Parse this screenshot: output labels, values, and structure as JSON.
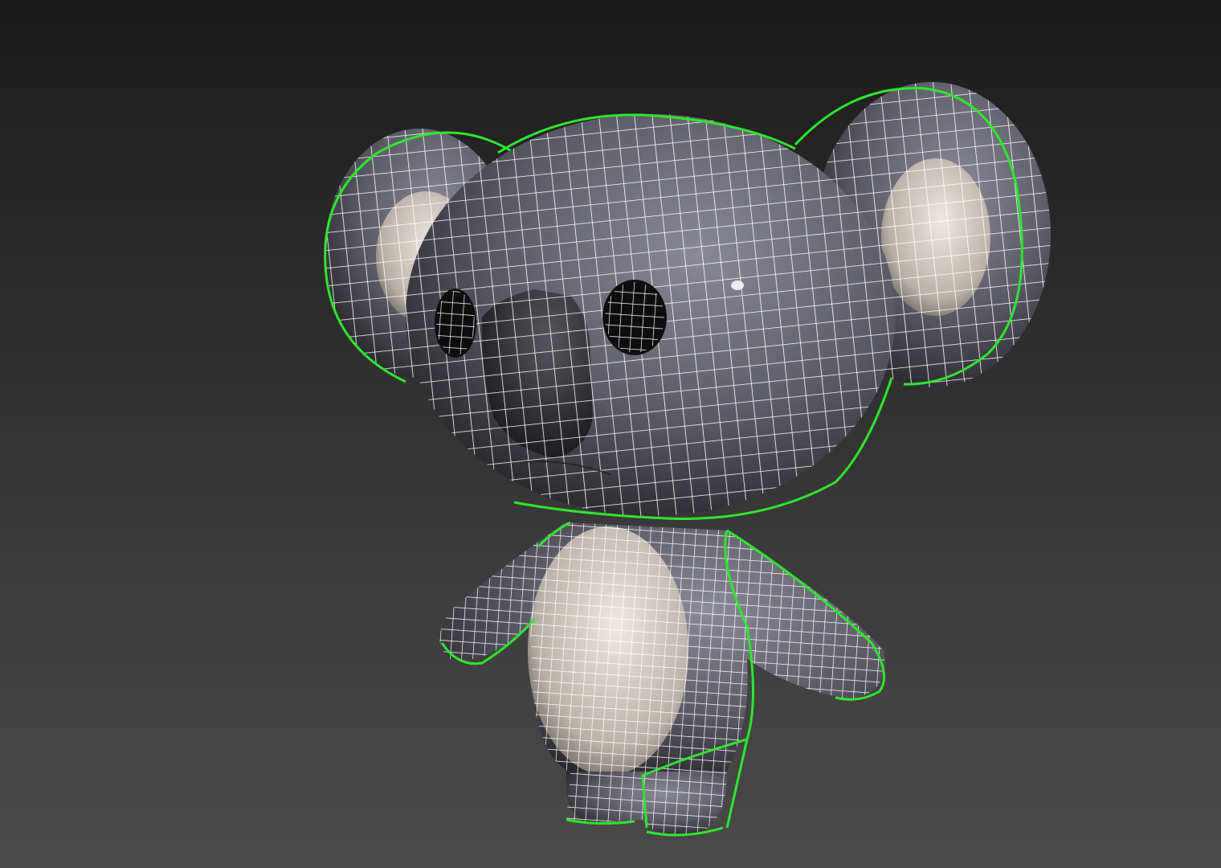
{
  "viewport": {
    "colors": {
      "selection_outline": "#2ee62e",
      "wireframe": "#ffffff",
      "fur": "#5c5c66",
      "belly": "#d8d2cc",
      "nose": "#2a2a2e"
    }
  }
}
